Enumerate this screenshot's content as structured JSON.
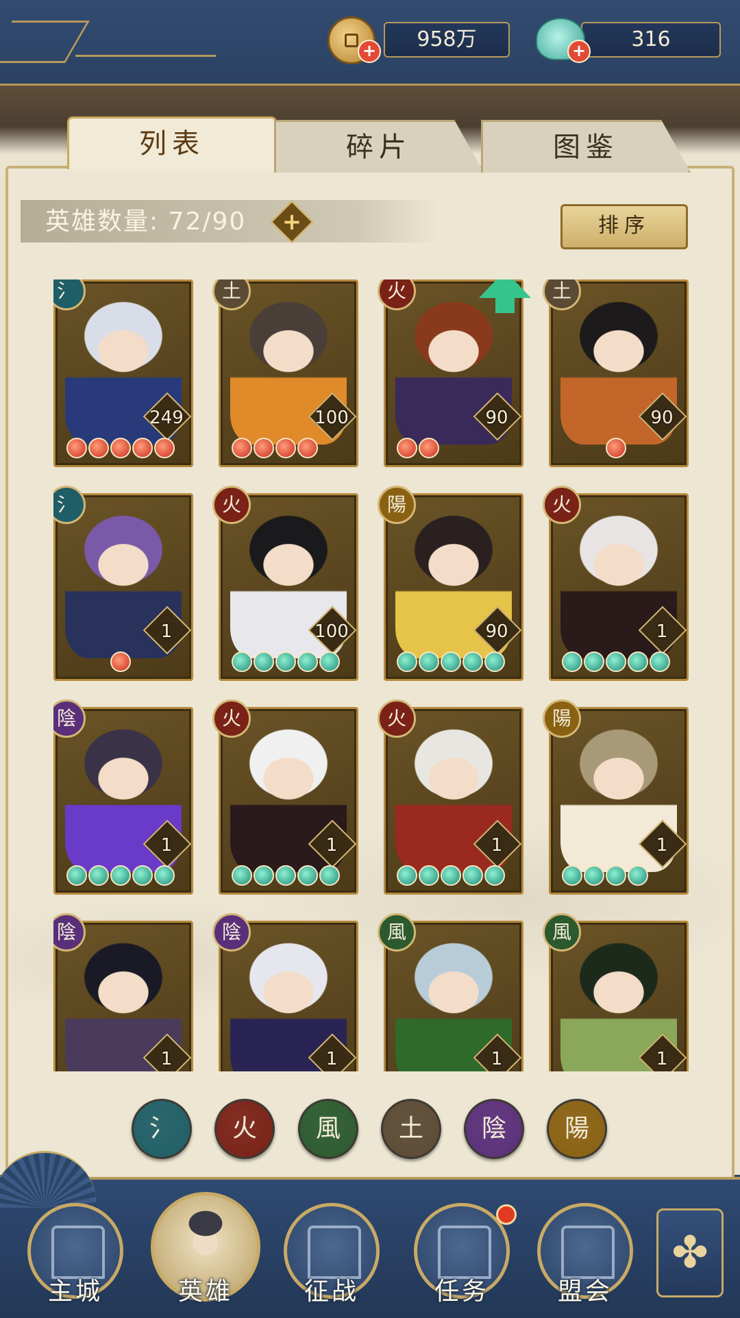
{
  "resources": {
    "coins": "958万",
    "shells": "316"
  },
  "tabs": [
    "列表",
    "碎片",
    "图鉴"
  ],
  "active_tab": 0,
  "hero_count": {
    "label": "英雄数量: 72/90"
  },
  "sort_button": "排序",
  "elements": {
    "water": {
      "glyph": "氵",
      "color": "#1f5e66"
    },
    "fire": {
      "glyph": "火",
      "color": "#7a2217"
    },
    "wind": {
      "glyph": "風",
      "color": "#2c5a2e"
    },
    "earth": {
      "glyph": "土",
      "color": "#5b4a34"
    },
    "yin": {
      "glyph": "陰",
      "color": "#5a2f7a"
    },
    "yang": {
      "glyph": "陽",
      "color": "#8a6112"
    }
  },
  "heroes": [
    {
      "element": "water",
      "level": "249",
      "stars": 5,
      "star_color": "red",
      "hair": "#d9dde8",
      "outfit": "#283a7a"
    },
    {
      "element": "earth",
      "level": "100",
      "stars": 4,
      "star_color": "red",
      "hair": "#4a3e38",
      "outfit": "#e08a2a"
    },
    {
      "element": "fire",
      "level": "90",
      "stars": 2,
      "star_color": "red",
      "hair": "#8a3a1c",
      "outfit": "#3a2a5a",
      "upgrade": true
    },
    {
      "element": "earth",
      "level": "90",
      "stars": 1,
      "star_color": "red",
      "hair": "#1c1a1a",
      "outfit": "#c2662a"
    },
    {
      "element": "water",
      "level": "1",
      "stars": 1,
      "star_color": "red",
      "hair": "#7a5aa8",
      "outfit": "#28325a"
    },
    {
      "element": "fire",
      "level": "100",
      "stars": 5,
      "star_color": "green",
      "hair": "#1a1a1c",
      "outfit": "#e8e8ec"
    },
    {
      "element": "yang",
      "level": "90",
      "stars": 5,
      "star_color": "green",
      "hair": "#2a2020",
      "outfit": "#e6c44a"
    },
    {
      "element": "fire",
      "level": "1",
      "stars": 5,
      "star_color": "green",
      "hair": "#e8e4e4",
      "outfit": "#2a1a1a"
    },
    {
      "element": "yin",
      "level": "1",
      "stars": 5,
      "star_color": "green",
      "hair": "#3a3246",
      "outfit": "#6a3ac8"
    },
    {
      "element": "fire",
      "level": "1",
      "stars": 5,
      "star_color": "green",
      "hair": "#f0f0f0",
      "outfit": "#2a1a1c"
    },
    {
      "element": "fire",
      "level": "1",
      "stars": 5,
      "star_color": "green",
      "hair": "#e8e6e0",
      "outfit": "#9a2a20"
    },
    {
      "element": "yang",
      "level": "1",
      "stars": 4,
      "star_color": "green",
      "hair": "#a89a78",
      "outfit": "#f2ead6"
    },
    {
      "element": "yin",
      "level": "1",
      "stars": 0,
      "star_color": "green",
      "hair": "#1a1a26",
      "outfit": "#4a3a5c"
    },
    {
      "element": "yin",
      "level": "1",
      "stars": 0,
      "star_color": "green",
      "hair": "#e6e6ee",
      "outfit": "#2a2454"
    },
    {
      "element": "wind",
      "level": "1",
      "stars": 0,
      "star_color": "green",
      "hair": "#b8ccd8",
      "outfit": "#2e6a2a"
    },
    {
      "element": "wind",
      "level": "1",
      "stars": 0,
      "star_color": "green",
      "hair": "#1c2a1c",
      "outfit": "#8aa85a"
    }
  ],
  "filters": [
    "water",
    "fire",
    "wind",
    "earth",
    "yin",
    "yang"
  ],
  "nav": [
    {
      "label": "主城",
      "icon": "city-gate-icon"
    },
    {
      "label": "英雄",
      "icon": "hero-portrait-icon",
      "active": true
    },
    {
      "label": "征战",
      "icon": "battle-horn-icon"
    },
    {
      "label": "任务",
      "icon": "quest-scroll-icon",
      "notify": true
    },
    {
      "label": "盟会",
      "icon": "alliance-hall-icon"
    }
  ],
  "more_icon": "clover-menu-icon"
}
